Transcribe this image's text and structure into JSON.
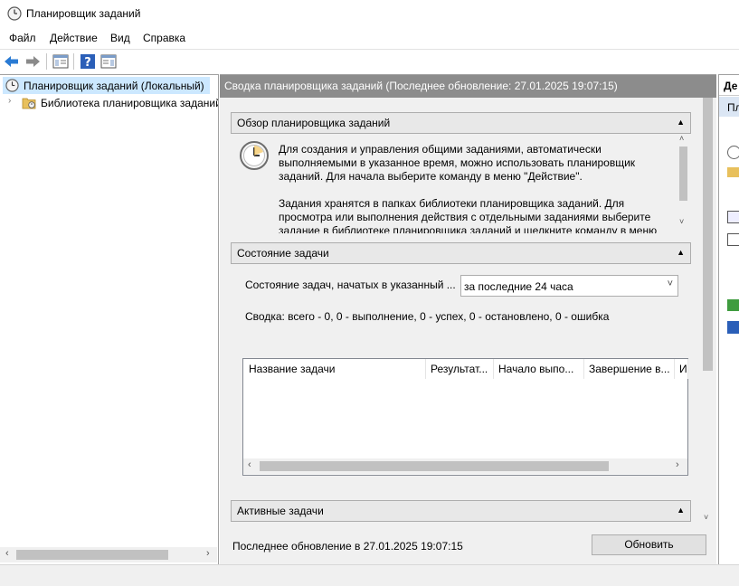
{
  "window": {
    "title": "Планировщик заданий"
  },
  "menu": {
    "items": [
      "Файл",
      "Действие",
      "Вид",
      "Справка"
    ]
  },
  "toolbar": {
    "buttons": [
      "back-icon",
      "forward-icon",
      "show-hide-tree-icon",
      "help-icon",
      "show-hide-action-pane-icon"
    ]
  },
  "tree": {
    "root_label": "Планировщик заданий (Локальный)",
    "child_label": "Библиотека планировщика заданий"
  },
  "center": {
    "header": "Сводка планировщика заданий (Последнее обновление: 27.01.2025 19:07:15)",
    "overview": {
      "title": "Обзор планировщика заданий",
      "para1": "Для создания и управления общими заданиями, автоматически выполняемыми в указанное время, можно использовать планировщик заданий. Для начала выберите команду в меню \"Действие\".",
      "para2": "Задания хранятся в папках библиотеки планировщика заданий. Для просмотра или выполнения действия с отдельными заданиями выберите задание в библиотеке планировщика заданий и щелкните команду в меню"
    },
    "status": {
      "title": "Состояние задачи",
      "filter_label": "Состояние задач, начатых в указанный ...",
      "filter_value": "за последние 24 часа",
      "summary": "Сводка: всего - 0, 0 - выполнение, 0 - успех, 0 - остановлено, 0 - ошибка",
      "columns": [
        "Название задачи",
        "Результат...",
        "Начало выпо...",
        "Завершение в...",
        "И"
      ]
    },
    "active": {
      "title": "Активные задачи"
    },
    "footer": {
      "last_update": "Последнее обновление в 27.01.2025 19:07:15",
      "refresh_button": "Обновить"
    }
  },
  "right": {
    "header": "Де",
    "subheader": "Пл"
  },
  "colors": {
    "selection": "#cce8ff",
    "header_bg": "#8c8c8c"
  }
}
